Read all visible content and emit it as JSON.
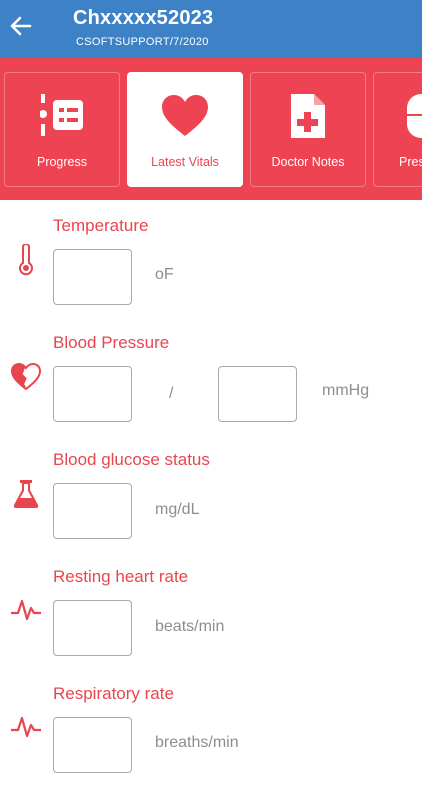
{
  "header": {
    "title": "Chxxxxx52023",
    "subtitle": "CSOFTSUPPORT/7/2020"
  },
  "tabs": [
    {
      "label": "Progress",
      "icon": "progress-list-icon",
      "active": false
    },
    {
      "label": "Latest Vitals",
      "icon": "heart-icon",
      "active": true
    },
    {
      "label": "Doctor Notes",
      "icon": "medical-document-icon",
      "active": false
    },
    {
      "label": "Pres",
      "icon": "pill-icon",
      "active": false
    }
  ],
  "vitals": {
    "temperature": {
      "title": "Temperature",
      "unit": "oF",
      "icon": "thermometer-icon"
    },
    "blood_pressure": {
      "title": "Blood Pressure",
      "separator": "/",
      "unit": "mmHg",
      "icon": "heart-outline-icon"
    },
    "glucose": {
      "title": "Blood glucose status",
      "unit": "mg/dL",
      "icon": "flask-icon"
    },
    "heart_rate": {
      "title": "Resting heart rate",
      "unit": "beats/min",
      "icon": "pulse-icon"
    },
    "respiratory": {
      "title": "Respiratory rate",
      "unit": "breaths/min",
      "icon": "pulse-icon"
    }
  },
  "colors": {
    "header": "#3d82c6",
    "accent": "#ee4352",
    "label": "#e8464f",
    "unit": "#8e8e8e"
  }
}
